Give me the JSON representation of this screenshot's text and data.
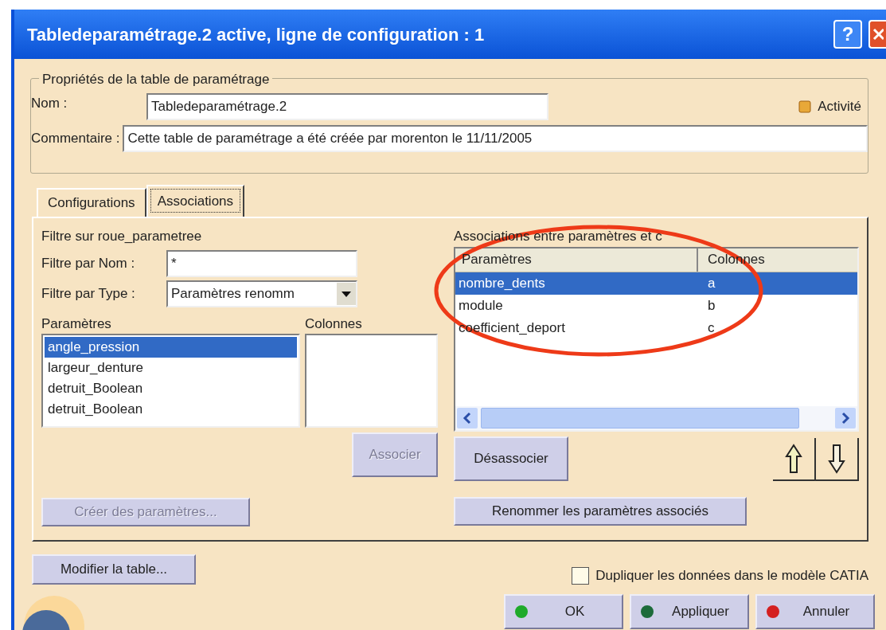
{
  "window": {
    "title": "Tabledeparamétrage.2 active, ligne de configuration : 1",
    "help": "?"
  },
  "properties": {
    "legend": "Propriétés de la table de paramétrage",
    "name_label": "Nom :",
    "name_value": "Tabledeparamétrage.2",
    "activity": "Activité",
    "comment_label": "Commentaire :",
    "comment_value": "Cette table de paramétrage a été créée par morenton le 11/11/2005"
  },
  "tabs": [
    {
      "label": "Configurations",
      "selected": false
    },
    {
      "label": "Associations",
      "selected": true
    }
  ],
  "filter": {
    "title": "Filtre sur roue_parametree",
    "name_label": "Filtre par Nom :",
    "name_value": "*",
    "type_label": "Filtre par Type :",
    "type_value": "Paramètres renomm"
  },
  "parameters": {
    "header": "Paramètres",
    "items": [
      {
        "label": "angle_pression",
        "selected": true
      },
      {
        "label": "largeur_denture",
        "selected": false
      },
      {
        "label": "detruit_Boolean",
        "selected": false
      },
      {
        "label": "detruit_Boolean",
        "selected": false
      }
    ]
  },
  "columns": {
    "header": "Colonnes"
  },
  "associate_button": {
    "label": "Associer",
    "disabled": true
  },
  "create_button": {
    "label": "Créer des paramètres...",
    "disabled": true
  },
  "associations": {
    "title": "Associations entre paramètres et c",
    "columns": [
      "Paramètres",
      "Colonnes"
    ],
    "rows": [
      {
        "parameter": "nombre_dents",
        "column": "a",
        "selected": true
      },
      {
        "parameter": "module",
        "column": "b",
        "selected": false
      },
      {
        "parameter": "coefficient_deport",
        "column": "c",
        "selected": false
      }
    ]
  },
  "dissociate_button": {
    "label": "Désassocier",
    "disabled": false
  },
  "rename_button": {
    "label": "Renommer les paramètres associés",
    "disabled": false
  },
  "modify_button": {
    "label": "Modifier la table...",
    "disabled": false
  },
  "duplicate": {
    "label": "Dupliquer les données dans le modèle CATIA",
    "checked": false
  },
  "dialog_buttons": [
    {
      "label": "OK",
      "color": "#1faa2a"
    },
    {
      "label": "Appliquer",
      "color": "#1d6b3a"
    },
    {
      "label": "Annuler",
      "color": "#d42020"
    }
  ]
}
